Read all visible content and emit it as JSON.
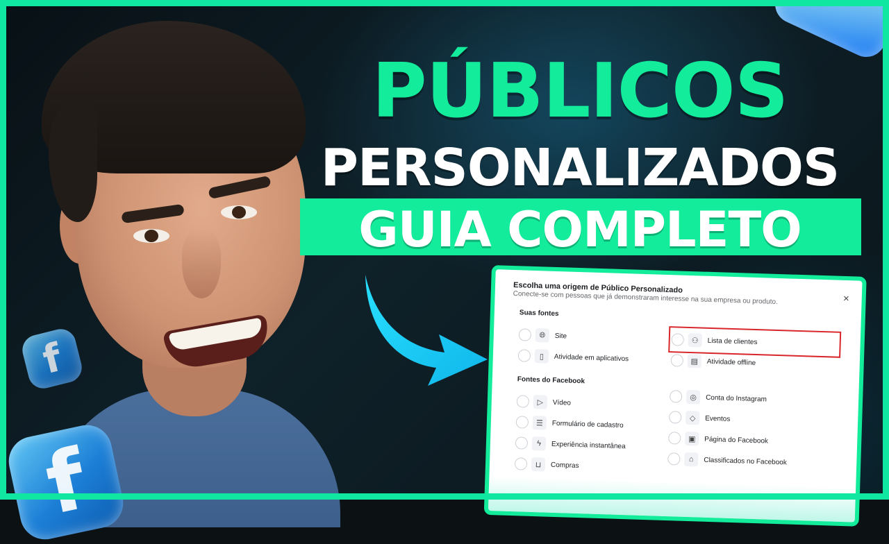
{
  "headline": {
    "line1": "PÚBLICOS",
    "line2": "PERSONALIZADOS",
    "line3": "GUIA COMPLETO"
  },
  "dialog": {
    "title": "Escolha uma origem de Público Personalizado",
    "subtitle": "Conecte-se com pessoas que já demonstraram interesse na sua empresa ou produto.",
    "close_label": "×",
    "sections": {
      "own_sources": {
        "heading": "Suas fontes",
        "left": [
          {
            "label": "Site",
            "icon": "globe-icon"
          },
          {
            "label": "Atividade em aplicativos",
            "icon": "phone-icon"
          }
        ],
        "right": [
          {
            "label": "Lista de clientes",
            "icon": "people-icon",
            "highlighted": true
          },
          {
            "label": "Atividade offline",
            "icon": "store-icon"
          }
        ]
      },
      "facebook_sources": {
        "heading": "Fontes do Facebook",
        "left": [
          {
            "label": "Vídeo",
            "icon": "play-icon"
          },
          {
            "label": "Formulário de cadastro",
            "icon": "form-icon"
          },
          {
            "label": "Experiência instantânea",
            "icon": "lightning-icon"
          },
          {
            "label": "Compras",
            "icon": "cart-icon"
          }
        ],
        "right": [
          {
            "label": "Conta do Instagram",
            "icon": "instagram-icon"
          },
          {
            "label": "Eventos",
            "icon": "ticket-icon"
          },
          {
            "label": "Página do Facebook",
            "icon": "page-icon"
          },
          {
            "label": "Classificados no Facebook",
            "icon": "marketplace-icon"
          }
        ]
      }
    }
  },
  "colors": {
    "accent_green": "#13ec9b",
    "frame_green": "#10e8a2",
    "arrow_cyan": "#17c8f2",
    "highlight_red": "#d8262b"
  },
  "decorations": {
    "facebook_glyph": "f"
  }
}
